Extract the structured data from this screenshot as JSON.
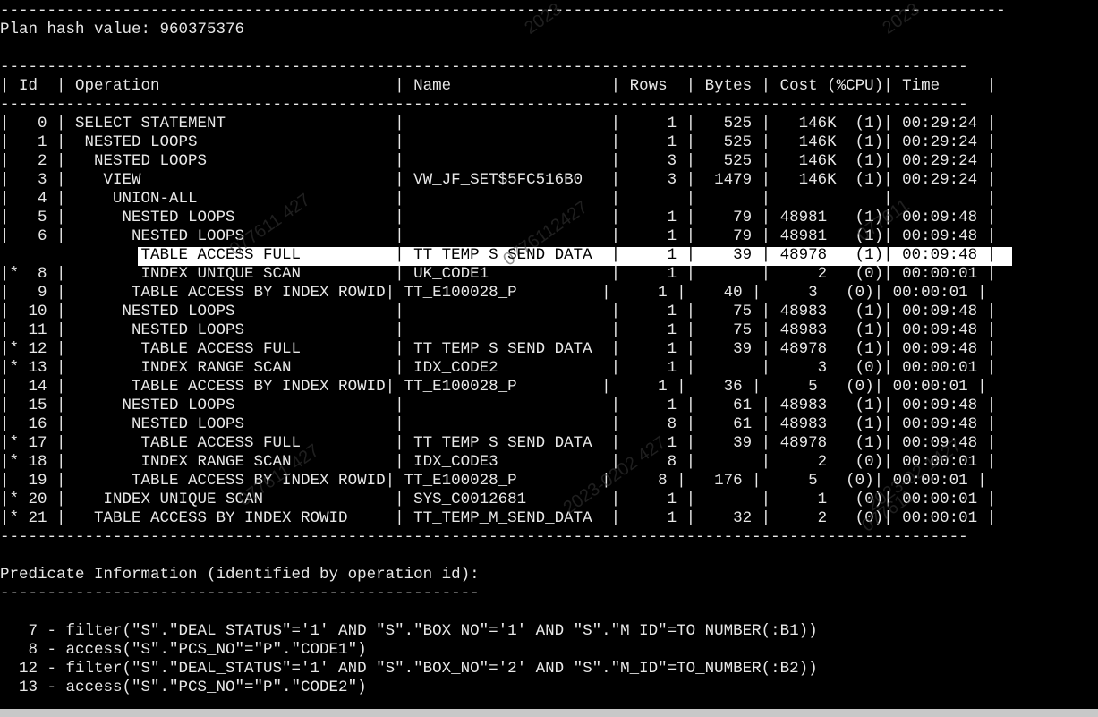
{
  "terminal": {
    "top_rule": "-----------------------------------------------------------------------------------------------------------",
    "plan_hash": "Plan hash value: 960375376",
    "rule": "-------------------------------------------------------------------------------------------------------",
    "header": "| Id  | Operation                         | Name                 | Rows  | Bytes | Cost (%CPU)| Time     |",
    "rows": [
      "|   0 | SELECT STATEMENT                  |                      |     1 |   525 |   146K  (1)| 00:29:24 |",
      "|   1 |  NESTED LOOPS                     |                      |     1 |   525 |   146K  (1)| 00:29:24 |",
      "|   2 |   NESTED LOOPS                    |                      |     3 |   525 |   146K  (1)| 00:29:24 |",
      "|   3 |    VIEW                           | VW_JF_SET$5FC516B0   |     3 |  1479 |   146K  (1)| 00:29:24 |",
      "|   4 |     UNION-ALL                     |                      |       |       |            |          |",
      "|   5 |      NESTED LOOPS                 |                      |     1 |    79 | 48981   (1)| 00:09:48 |",
      "|   6 |       NESTED LOOPS                |                      |     1 |    79 | 48981   (1)| 00:09:48 |",
      "|*  7 |        TABLE ACCESS FULL          | TT_TEMP_S_SEND_DATA  |     1 |    39 | 48978   (1)| 00:09:48 |",
      "|*  8 |        INDEX UNIQUE SCAN          | UK_CODE1             |     1 |       |     2   (0)| 00:00:01 |",
      "|   9 |       TABLE ACCESS BY INDEX ROWID| TT_E100028_P         |     1 |    40 |     3   (0)| 00:00:01 |",
      "|  10 |      NESTED LOOPS                 |                      |     1 |    75 | 48983   (1)| 00:09:48 |",
      "|  11 |       NESTED LOOPS                |                      |     1 |    75 | 48983   (1)| 00:09:48 |",
      "|* 12 |        TABLE ACCESS FULL          | TT_TEMP_S_SEND_DATA  |     1 |    39 | 48978   (1)| 00:09:48 |",
      "|* 13 |        INDEX RANGE SCAN           | IDX_CODE2            |     1 |       |     3   (0)| 00:00:01 |",
      "|  14 |       TABLE ACCESS BY INDEX ROWID| TT_E100028_P         |     1 |    36 |     5   (0)| 00:00:01 |",
      "|  15 |      NESTED LOOPS                 |                      |     1 |    61 | 48983   (1)| 00:09:48 |",
      "|  16 |       NESTED LOOPS                |                      |     8 |    61 | 48983   (1)| 00:09:48 |",
      "|* 17 |        TABLE ACCESS FULL          | TT_TEMP_S_SEND_DATA  |     1 |    39 | 48978   (1)| 00:09:48 |",
      "|* 18 |        INDEX RANGE SCAN           | IDX_CODE3            |     8 |       |     2   (0)| 00:00:01 |",
      "|  19 |       TABLE ACCESS BY INDEX ROWID| TT_E100028_P         |     8 |   176 |     5   (0)| 00:00:01 |",
      "|* 20 |    INDEX UNIQUE SCAN              | SYS_C0012681         |     1 |       |     1   (0)| 00:00:01 |",
      "|* 21 |   TABLE ACCESS BY INDEX ROWID     | TT_TEMP_M_SEND_DATA  |     1 |    32 |     2   (0)| 00:00:01 |"
    ],
    "predicate_title": "Predicate Information (identified by operation id):",
    "predicate_rule": "---------------------------------------------------",
    "predicates": [
      "   7 - filter(\"S\".\"DEAL_STATUS\"='1' AND \"S\".\"BOX_NO\"='1' AND \"S\".\"M_ID\"=TO_NUMBER(:B1))",
      "   8 - access(\"S\".\"PCS_NO\"=\"P\".\"CODE1\")",
      "  12 - filter(\"S\".\"DEAL_STATUS\"='1' AND \"S\".\"BOX_NO\"='2' AND \"S\".\"M_ID\"=TO_NUMBER(:B2))",
      "  13 - access(\"S\".\"PCS_NO\"=\"P\".\"CODE2\")"
    ],
    "watermarks": [
      "2023",
      "2023",
      "077611 427",
      "0776112427",
      "077611",
      "2023-0202 427",
      "077611 427",
      "2023-02 1427",
      "077611"
    ]
  }
}
